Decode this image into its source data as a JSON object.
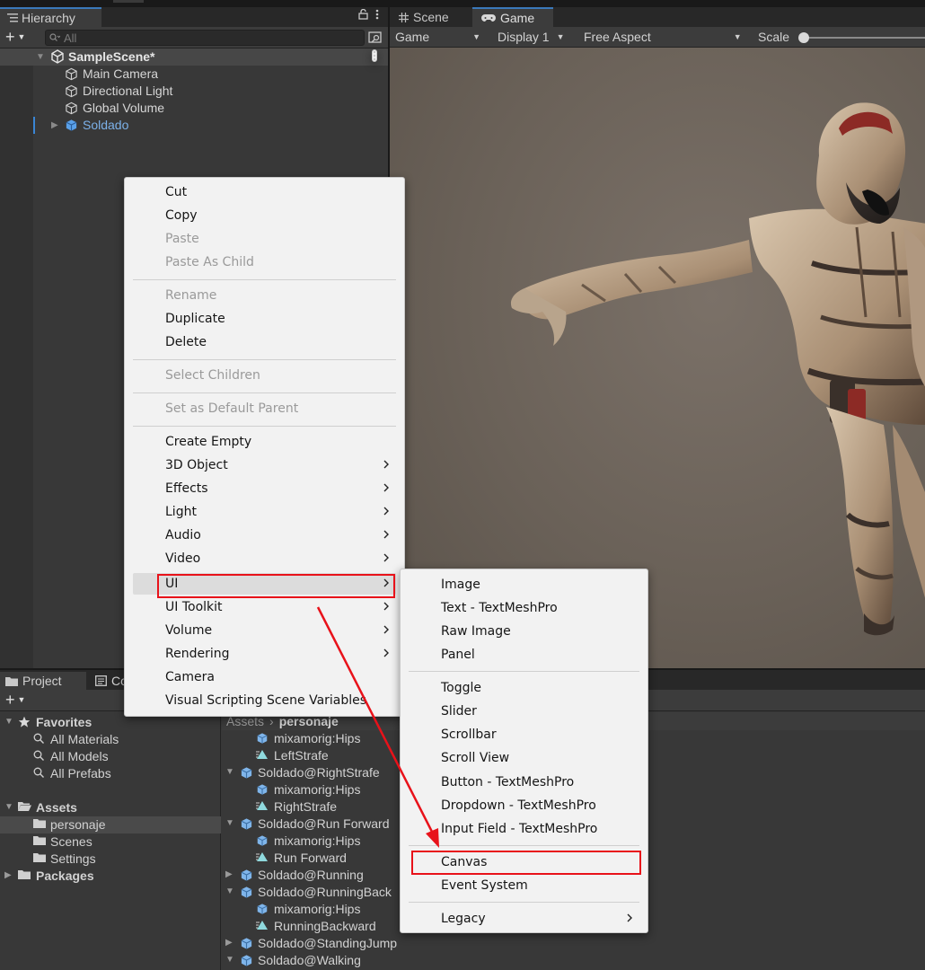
{
  "hierarchy": {
    "tab_label": "Hierarchy",
    "search_placeholder": "All",
    "scene_name": "SampleScene*",
    "items": [
      {
        "label": "Main Camera"
      },
      {
        "label": "Directional Light"
      },
      {
        "label": "Global Volume"
      },
      {
        "label": "Soldado"
      }
    ]
  },
  "game": {
    "tab_scene": "Scene",
    "tab_game": "Game",
    "toolbar": {
      "mode": "Game",
      "display": "Display 1",
      "aspect": "Free Aspect",
      "scale_label": "Scale"
    }
  },
  "project": {
    "tab_project": "Project",
    "tab_console": "Co",
    "tree": {
      "favorites_label": "Favorites",
      "favorites": [
        "All Materials",
        "All Models",
        "All Prefabs"
      ],
      "assets_label": "Assets",
      "assets": [
        "personaje",
        "Scenes",
        "Settings"
      ],
      "packages_label": "Packages"
    },
    "breadcrumb": {
      "root": "Assets",
      "current": "personaje"
    },
    "files": [
      {
        "label": "mixamorig:Hips",
        "kind": "mesh"
      },
      {
        "label": "LeftStrafe",
        "kind": "anim"
      },
      {
        "label": "Soldado@RightStrafe",
        "kind": "model"
      },
      {
        "label": "mixamorig:Hips",
        "kind": "mesh"
      },
      {
        "label": "RightStrafe",
        "kind": "anim"
      },
      {
        "label": "Soldado@Run Forward",
        "kind": "model"
      },
      {
        "label": "mixamorig:Hips",
        "kind": "mesh"
      },
      {
        "label": "Run Forward",
        "kind": "anim"
      },
      {
        "label": "Soldado@Running",
        "kind": "model"
      },
      {
        "label": "Soldado@RunningBack",
        "kind": "model"
      },
      {
        "label": "mixamorig:Hips",
        "kind": "mesh"
      },
      {
        "label": "RunningBackward",
        "kind": "anim"
      },
      {
        "label": "Soldado@StandingJump",
        "kind": "model"
      },
      {
        "label": "Soldado@Walking",
        "kind": "model"
      }
    ]
  },
  "context_menu": {
    "items": [
      {
        "label": "Cut"
      },
      {
        "label": "Copy"
      },
      {
        "label": "Paste"
      },
      {
        "label": "Paste As Child"
      },
      {
        "label": "Rename"
      },
      {
        "label": "Duplicate"
      },
      {
        "label": "Delete"
      },
      {
        "label": "Select Children"
      },
      {
        "label": "Set as Default Parent"
      },
      {
        "label": "Create Empty"
      },
      {
        "label": "3D Object"
      },
      {
        "label": "Effects"
      },
      {
        "label": "Light"
      },
      {
        "label": "Audio"
      },
      {
        "label": "Video"
      },
      {
        "label": "UI"
      },
      {
        "label": "UI Toolkit"
      },
      {
        "label": "Volume"
      },
      {
        "label": "Rendering"
      },
      {
        "label": "Camera"
      },
      {
        "label": "Visual Scripting Scene Variables"
      }
    ]
  },
  "ui_submenu": {
    "items": [
      {
        "label": "Image"
      },
      {
        "label": "Text - TextMeshPro"
      },
      {
        "label": "Raw Image"
      },
      {
        "label": "Panel"
      },
      {
        "label": "Toggle"
      },
      {
        "label": "Slider"
      },
      {
        "label": "Scrollbar"
      },
      {
        "label": "Scroll View"
      },
      {
        "label": "Button - TextMeshPro"
      },
      {
        "label": "Dropdown - TextMeshPro"
      },
      {
        "label": "Input Field - TextMeshPro"
      },
      {
        "label": "Canvas"
      },
      {
        "label": "Event System"
      },
      {
        "label": "Legacy"
      }
    ]
  },
  "colors": {
    "highlight": "#e8121a",
    "prefab_text": "#7cb1e9",
    "panel": "#383838",
    "menu_bg": "#f2f2f2"
  }
}
